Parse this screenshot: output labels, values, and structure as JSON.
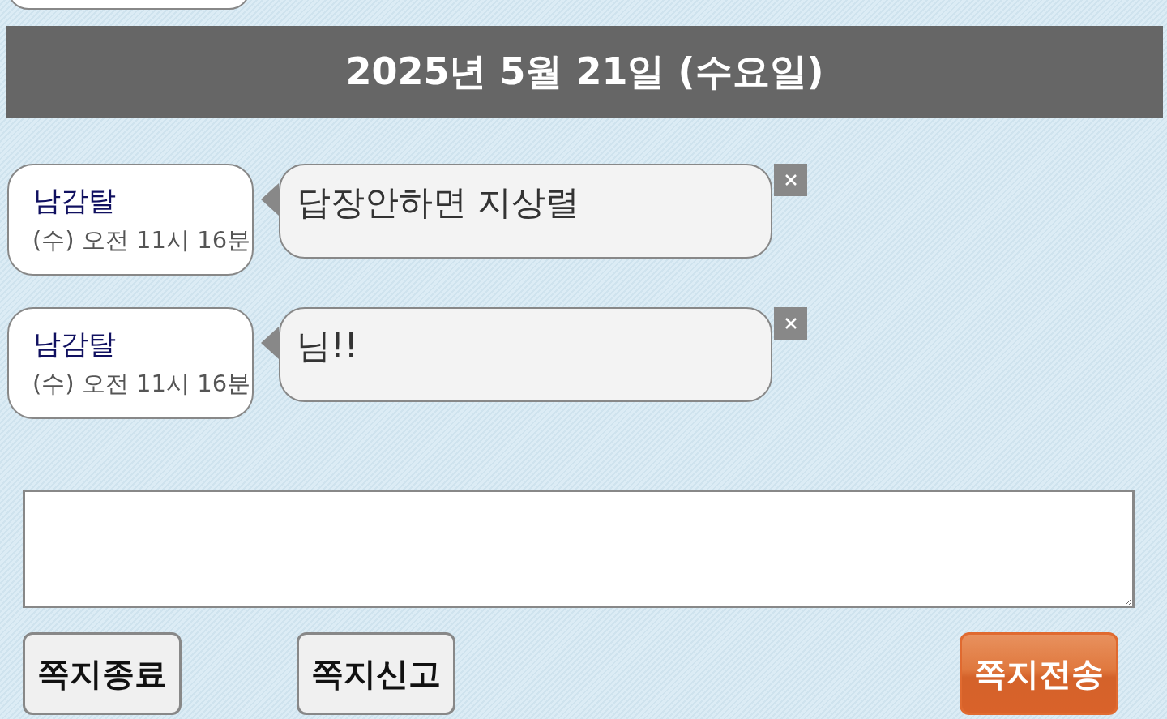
{
  "date_header": "2025년 5월 21일 (수요일)",
  "messages": [
    {
      "sender": "남감탈",
      "time": "(수) 오전 11시 16분",
      "text": "답장안하면 지상렬"
    },
    {
      "sender": "남감탈",
      "time": "(수) 오전 11시 16분",
      "text": "님!!"
    }
  ],
  "buttons": [
    {
      "label": "쪽지종료",
      "kind": "plain"
    },
    {
      "label": "쪽지신고",
      "kind": "plain"
    },
    {
      "label": "쪽지전송",
      "kind": "primary"
    }
  ]
}
